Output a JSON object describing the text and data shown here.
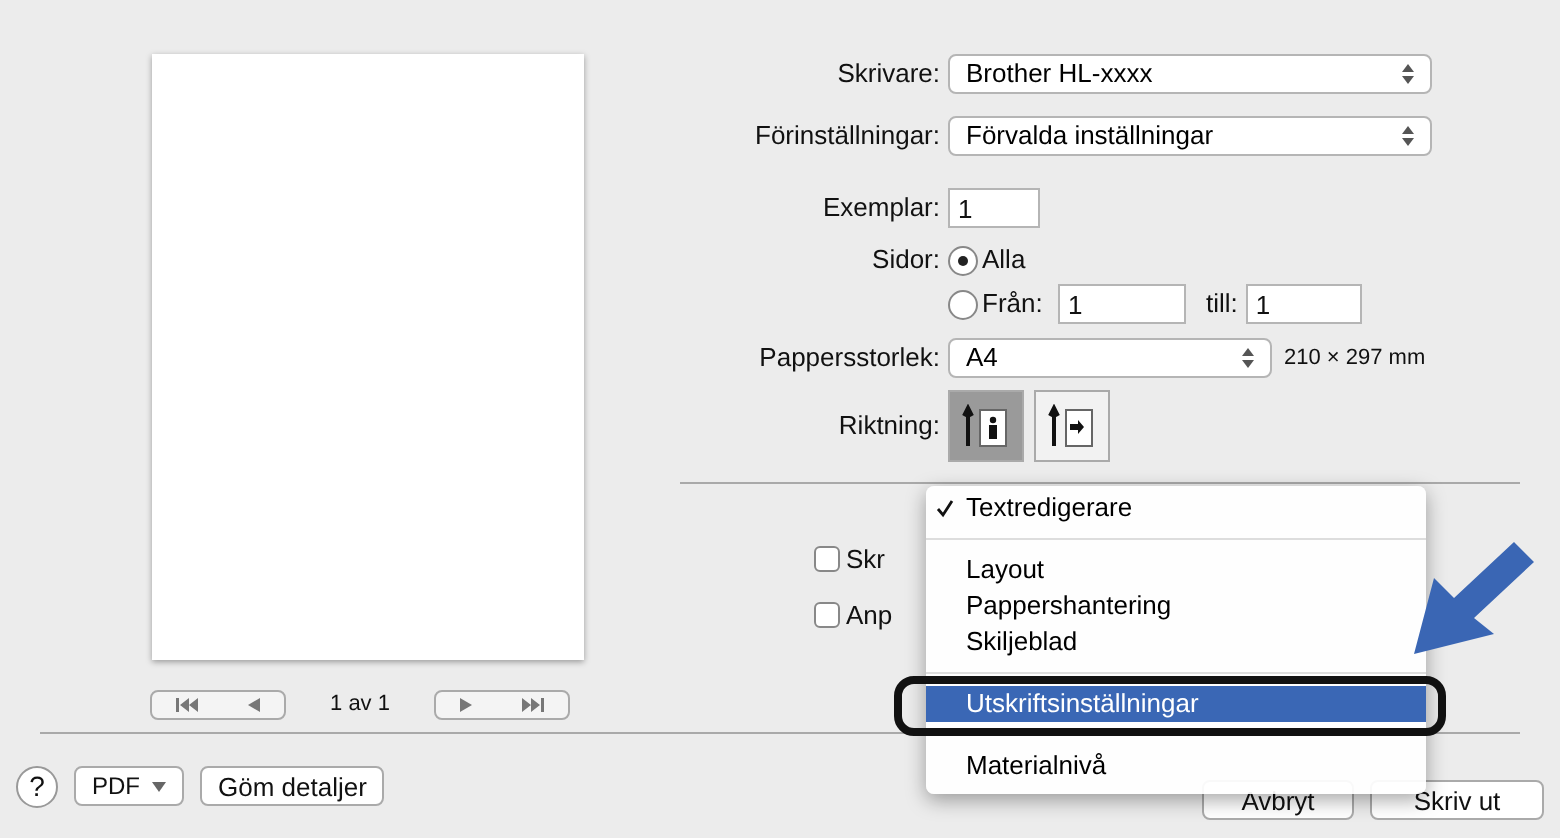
{
  "preview": {
    "page_counter": "1 av 1"
  },
  "form": {
    "printer": {
      "label": "Skrivare:",
      "value": "Brother HL-xxxx"
    },
    "presets": {
      "label": "Förinställningar:",
      "value": "Förvalda inställningar"
    },
    "copies": {
      "label": "Exemplar:",
      "value": "1"
    },
    "pages": {
      "label": "Sidor:",
      "options": [
        {
          "label": "Alla",
          "selected": true
        },
        {
          "label": "Från:",
          "selected": false
        }
      ],
      "from": "1",
      "to_label": "till:",
      "to": "1"
    },
    "paper_size": {
      "label": "Pappersstorlek:",
      "value": "A4",
      "dimensions": "210 × 297 mm"
    },
    "orientation": {
      "label": "Riktning:",
      "options": [
        {
          "kind": "portrait",
          "selected": true
        },
        {
          "kind": "landscape",
          "selected": false
        }
      ]
    },
    "checkboxes": [
      {
        "label": "Skr",
        "checked": false
      },
      {
        "label": "Anp",
        "checked": false
      }
    ]
  },
  "menu": {
    "sections": [
      {
        "items": [
          {
            "label": "Textredigerare",
            "checked": true,
            "highlighted": false
          }
        ]
      },
      {
        "items": [
          {
            "label": "Layout",
            "checked": false,
            "highlighted": false
          },
          {
            "label": "Pappershantering",
            "checked": false,
            "highlighted": false
          },
          {
            "label": "Skiljeblad",
            "checked": false,
            "highlighted": false
          }
        ]
      },
      {
        "items": [
          {
            "label": "Utskriftsinställningar",
            "checked": false,
            "highlighted": true
          }
        ]
      },
      {
        "items": [
          {
            "label": "Materialnivå",
            "checked": false,
            "highlighted": false
          }
        ]
      }
    ]
  },
  "footer": {
    "help": "?",
    "pdf": "PDF",
    "hide_details": "Göm detaljer",
    "cancel": "Avbryt",
    "print": "Skriv ut"
  }
}
